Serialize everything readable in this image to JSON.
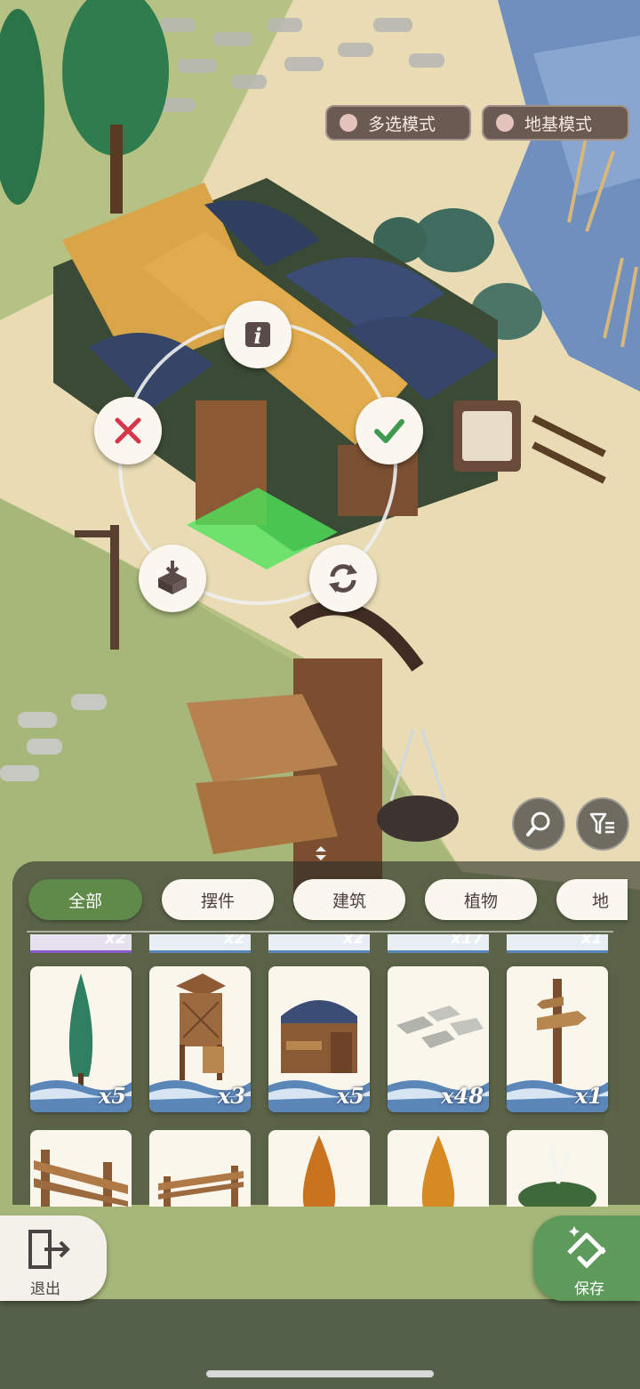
{
  "modes": {
    "multi_select": "多选模式",
    "foundation": "地基模式"
  },
  "tabs": [
    {
      "label": "全部",
      "active": true
    },
    {
      "label": "摆件",
      "active": false
    },
    {
      "label": "建筑",
      "active": false
    },
    {
      "label": "植物",
      "active": false
    },
    {
      "label": "地",
      "active": false
    }
  ],
  "previous_row_counts": [
    "x2",
    "x2",
    "x2",
    "x17",
    "x1"
  ],
  "inventory": [
    {
      "item_icon": "cypress-tree",
      "count": "x5"
    },
    {
      "item_icon": "wooden-watchtower",
      "count": "x3"
    },
    {
      "item_icon": "barrel-roof-house",
      "count": "x5"
    },
    {
      "item_icon": "stepping-stones",
      "count": "x48"
    },
    {
      "item_icon": "signpost",
      "count": "x1"
    }
  ],
  "inventory_row2": [
    {
      "item_icon": "wooden-fence"
    },
    {
      "item_icon": "low-fence"
    },
    {
      "item_icon": "autumn-tree"
    },
    {
      "item_icon": "autumn-tree"
    },
    {
      "item_icon": "white-flower-bush"
    }
  ],
  "buttons": {
    "exit": "退出",
    "save": "保存"
  },
  "colors": {
    "active_tab": "#5f8a4a",
    "confirm": "#3e9a4e",
    "cancel": "#d6354a",
    "save_button": "#5e9a5c"
  }
}
